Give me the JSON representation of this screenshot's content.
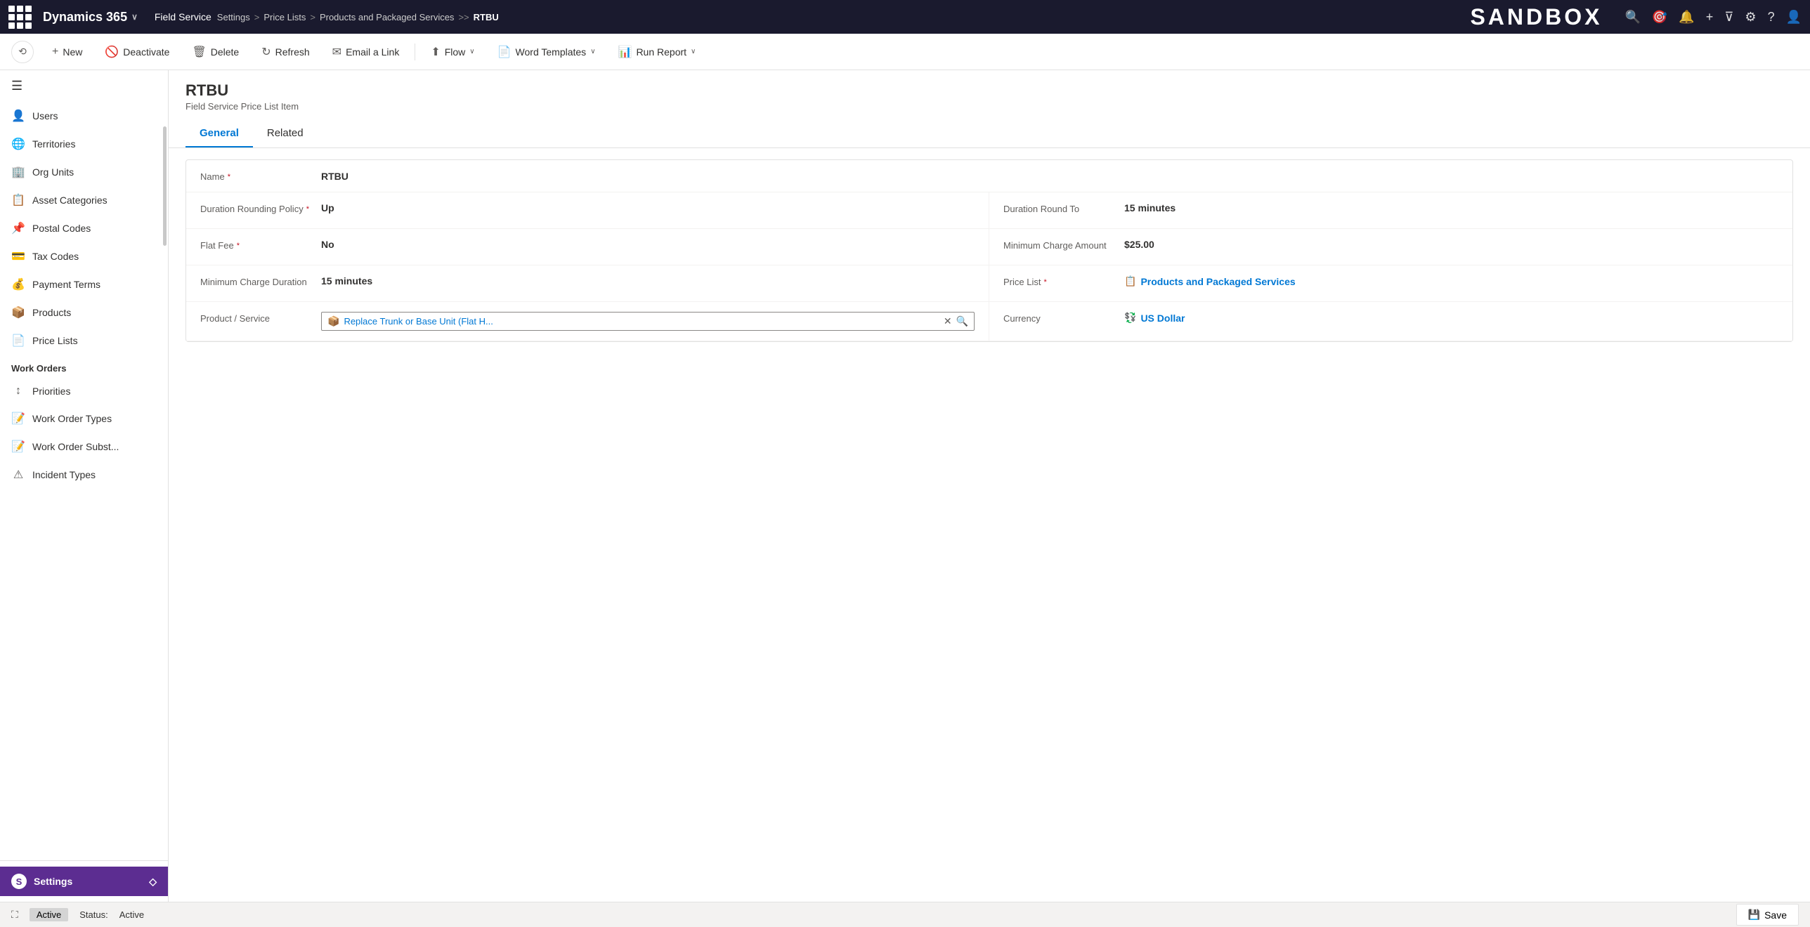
{
  "topNav": {
    "brand": "Dynamics 365",
    "app": "Field Service",
    "breadcrumbs": [
      "Settings",
      "Price Lists",
      "Products and Packaged Services",
      "RTBU"
    ],
    "sandboxLabel": "SANDBOX"
  },
  "commandBar": {
    "historyIcon": "⟲",
    "buttons": [
      {
        "id": "new",
        "label": "New",
        "icon": "+"
      },
      {
        "id": "deactivate",
        "label": "Deactivate",
        "icon": "🚫"
      },
      {
        "id": "delete",
        "label": "Delete",
        "icon": "🗑"
      },
      {
        "id": "refresh",
        "label": "Refresh",
        "icon": "↻"
      },
      {
        "id": "email-link",
        "label": "Email a Link",
        "icon": "✉"
      },
      {
        "id": "flow",
        "label": "Flow",
        "icon": "⬆",
        "hasChevron": true
      },
      {
        "id": "word-templates",
        "label": "Word Templates",
        "icon": "📄",
        "hasChevron": true
      },
      {
        "id": "run-report",
        "label": "Run Report",
        "icon": "📊",
        "hasChevron": true
      }
    ]
  },
  "sidebar": {
    "sections": [
      {
        "items": [
          {
            "id": "users",
            "label": "Users",
            "icon": "👤"
          },
          {
            "id": "territories",
            "label": "Territories",
            "icon": "🌐"
          },
          {
            "id": "org-units",
            "label": "Org Units",
            "icon": "🏢"
          },
          {
            "id": "asset-categories",
            "label": "Asset Categories",
            "icon": "📋"
          },
          {
            "id": "postal-codes",
            "label": "Postal Codes",
            "icon": "📌"
          },
          {
            "id": "tax-codes",
            "label": "Tax Codes",
            "icon": "💳"
          },
          {
            "id": "payment-terms",
            "label": "Payment Terms",
            "icon": "💰"
          },
          {
            "id": "products",
            "label": "Products",
            "icon": "📦"
          },
          {
            "id": "price-lists",
            "label": "Price Lists",
            "icon": "📄"
          }
        ]
      },
      {
        "header": "Work Orders",
        "items": [
          {
            "id": "priorities",
            "label": "Priorities",
            "icon": "↕"
          },
          {
            "id": "work-order-types",
            "label": "Work Order Types",
            "icon": "📝"
          },
          {
            "id": "work-order-subst",
            "label": "Work Order Subst...",
            "icon": "📝"
          },
          {
            "id": "incident-types",
            "label": "Incident Types",
            "icon": "⚠"
          }
        ]
      }
    ],
    "bottom": {
      "label": "Settings",
      "icon": "S",
      "chevron": "◇"
    }
  },
  "record": {
    "title": "RTBU",
    "subtitle": "Field Service Price List Item",
    "tabs": [
      {
        "id": "general",
        "label": "General",
        "active": true
      },
      {
        "id": "related",
        "label": "Related",
        "active": false
      }
    ]
  },
  "form": {
    "fields": {
      "name": {
        "label": "Name",
        "required": true,
        "value": "RTBU"
      },
      "durationRoundingPolicy": {
        "label": "Duration Rounding Policy",
        "required": true,
        "value": "Up"
      },
      "durationRoundTo": {
        "label": "Duration Round To",
        "value": "15 minutes"
      },
      "flatFee": {
        "label": "Flat Fee",
        "required": true,
        "value": "No"
      },
      "minimumChargeAmount": {
        "label": "Minimum Charge Amount",
        "value": "$25.00"
      },
      "minimumChargeDuration": {
        "label": "Minimum Charge Duration",
        "value": "15 minutes"
      },
      "priceList": {
        "label": "Price List",
        "required": true,
        "value": "Products and Packaged Services",
        "isLink": true
      },
      "productService": {
        "label": "Product / Service",
        "value": "Replace Trunk or Base Unit (Flat H...",
        "isLookup": true
      },
      "currency": {
        "label": "Currency",
        "value": "US Dollar",
        "isLink": true
      }
    }
  },
  "statusBar": {
    "activeLabel": "Active",
    "statusLabel": "Status:",
    "statusValue": "Active",
    "saveLabel": "Save",
    "saveIcon": "💾"
  }
}
